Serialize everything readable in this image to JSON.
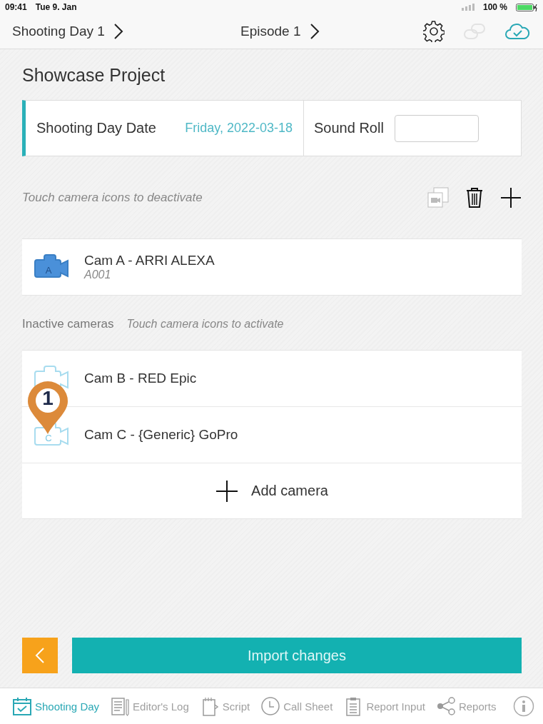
{
  "status_bar": {
    "time": "09:41",
    "date": "Tue 9. Jan",
    "battery": "100 %"
  },
  "nav": {
    "day": "Shooting Day 1",
    "episode": "Episode 1",
    "cloud_synced": true
  },
  "project_title": "Showcase Project",
  "date_card": {
    "label": "Shooting Day Date",
    "value": "Friday, 2022-03-18",
    "sound_roll_label": "Sound Roll"
  },
  "active_section": {
    "hint": "Touch camera icons to deactivate",
    "cameras": [
      {
        "letter": "A",
        "name": "Cam A - ARRI ALEXA",
        "roll": "A001",
        "active": true
      }
    ]
  },
  "inactive_section": {
    "label": "Inactive cameras",
    "hint": "Touch camera icons to activate",
    "cameras": [
      {
        "name": "Cam B - RED Epic",
        "active": false
      },
      {
        "letter": "C",
        "name": "Cam C - {Generic} GoPro",
        "active": false
      }
    ],
    "add_label": "Add camera"
  },
  "marker": {
    "label": "1"
  },
  "import_button": "Import changes",
  "tabs": [
    {
      "label": "Shooting Day",
      "selected": true
    },
    {
      "label": "Editor's Log",
      "selected": false
    },
    {
      "label": "Script",
      "selected": false
    },
    {
      "label": "Call Sheet",
      "selected": false
    },
    {
      "label": "Report Input",
      "selected": false
    },
    {
      "label": "Reports",
      "selected": false
    }
  ]
}
